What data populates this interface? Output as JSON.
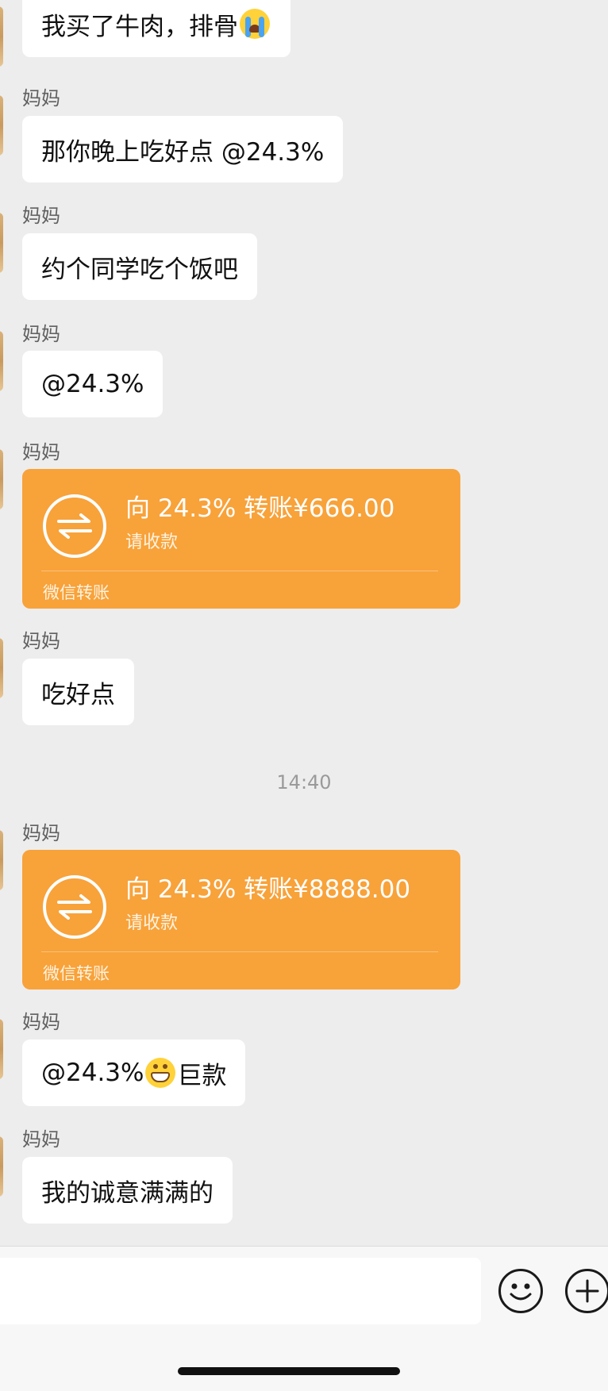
{
  "messages": [
    {
      "sender": "",
      "text": "我买了牛肉，排骨",
      "emoji": "loudly-crying-face"
    },
    {
      "sender": "妈妈",
      "text": "那你晚上吃好点 @24.3%"
    },
    {
      "sender": "妈妈",
      "text": "约个同学吃个饭吧"
    },
    {
      "sender": "妈妈",
      "text": "@24.3%"
    },
    {
      "sender": "妈妈",
      "transfer": {
        "amount_text": "向 24.3% 转账¥666.00",
        "status": "请收款",
        "label": "微信转账"
      }
    },
    {
      "sender": "妈妈",
      "text": "吃好点"
    },
    {
      "sender": "妈妈",
      "transfer": {
        "amount_text": "向 24.3% 转账¥8888.00",
        "status": "请收款",
        "label": "微信转账"
      }
    },
    {
      "sender": "妈妈",
      "text_before": "@24.3%",
      "emoji": "grinning-face",
      "text_after": "巨款"
    },
    {
      "sender": "妈妈",
      "text": "我的诚意满满的"
    }
  ],
  "timestamp": "14:40",
  "colors": {
    "background": "#ededed",
    "bubble": "#ffffff",
    "transfer": "#f8a23a",
    "sender": "#606060"
  },
  "input_bar": {
    "icons": [
      "smile-icon",
      "plus-icon"
    ]
  }
}
